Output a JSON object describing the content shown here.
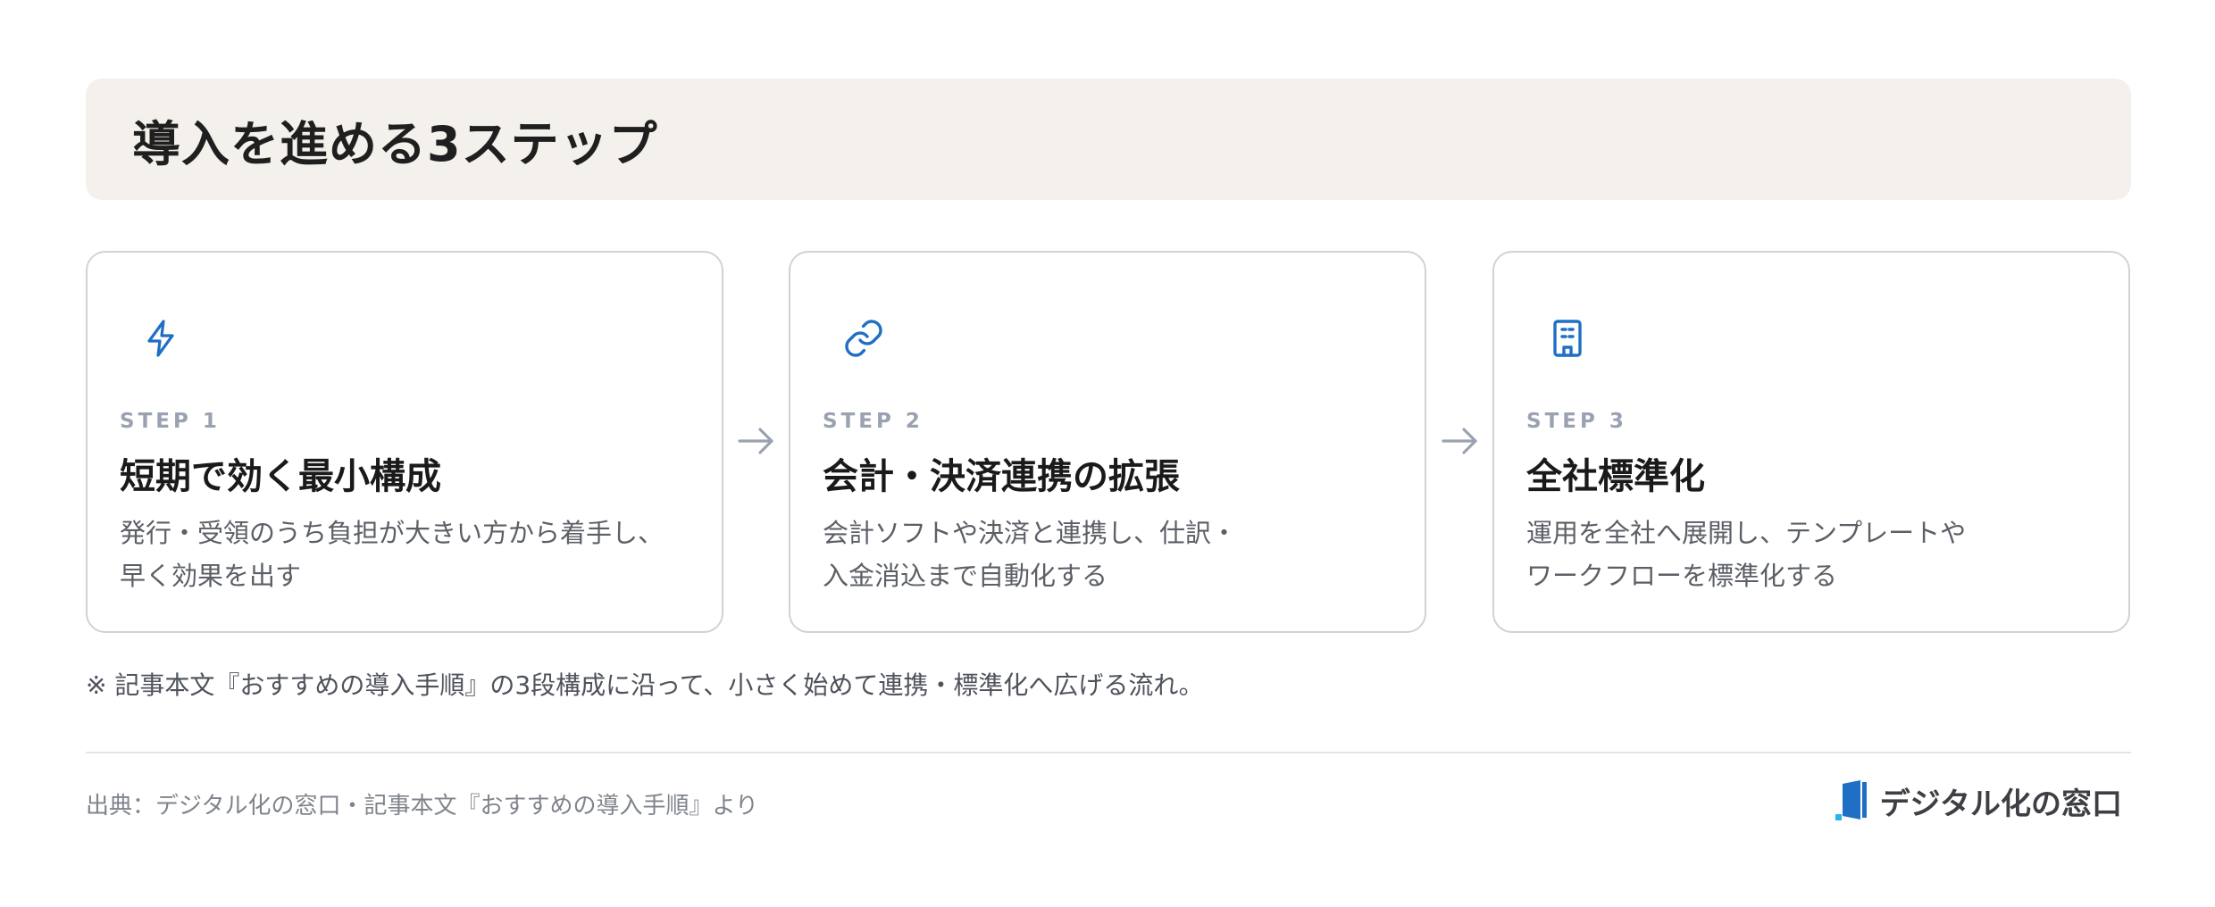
{
  "header": {
    "title": "導入を進める3ステップ"
  },
  "steps": [
    {
      "icon": "lightning-bolt-icon",
      "label": "STEP 1",
      "title": "短期で効く最小構成",
      "description_lines": [
        "発行・受領のうち負担が大きい方から着手し、",
        "早く効果を出す"
      ]
    },
    {
      "icon": "link-icon",
      "label": "STEP 2",
      "title": "会計・決済連携の拡張",
      "description_lines": [
        "会計ソフトや決済と連携し、仕訳・",
        "入金消込まで自動化する"
      ]
    },
    {
      "icon": "building-icon",
      "label": "STEP 3",
      "title": "全社標準化",
      "description_lines": [
        "運用を全社へ展開し、テンプレートや",
        "ワークフローを標準化する"
      ]
    }
  ],
  "note": "※ 記事本文『おすすめの導入手順』の3段構成に沿って、小さく始めて連携・標準化へ広げる流れ。",
  "footer": {
    "source": "出典：デジタル化の窓口・記事本文『おすすめの導入手順』より",
    "brand_name": "デジタル化の窓口"
  },
  "colors": {
    "accent": "#1f6fc4",
    "title_background": "#f4f1ec",
    "card_border": "#cfd2d8",
    "step_label": "#9aa2b1",
    "arrow": "#9aa2b1"
  }
}
